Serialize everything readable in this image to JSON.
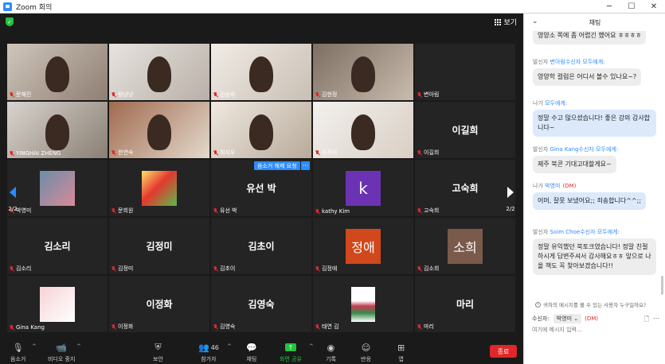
{
  "window": {
    "title": "Zoom 회의",
    "minimize": "─",
    "maximize": "☐",
    "close": "✕"
  },
  "view_button": "보기",
  "tiles": [
    {
      "name": "문혜진",
      "big": ""
    },
    {
      "name": "탱냥냥",
      "big": ""
    },
    {
      "name": "김송희",
      "big": ""
    },
    {
      "name": "김현정",
      "big": ""
    },
    {
      "name": "변아림",
      "big": ""
    },
    {
      "name": "YINGHAI ZHENG",
      "big": ""
    },
    {
      "name": "한연숙",
      "big": ""
    },
    {
      "name": "최지우",
      "big": ""
    },
    {
      "name": "조주미",
      "big": ""
    },
    {
      "name": "이길희",
      "big": "이길희"
    },
    {
      "name": "박영미",
      "big": ""
    },
    {
      "name": "문희원",
      "big": ""
    },
    {
      "name": "유선 박",
      "big": "유선 박"
    },
    {
      "name": "kathy Kim",
      "big": "",
      "avatar": "k"
    },
    {
      "name": "고숙희",
      "big": "고숙희"
    },
    {
      "name": "김소리",
      "big": "김소리"
    },
    {
      "name": "김정미",
      "big": "김정미"
    },
    {
      "name": "김초이",
      "big": "김초이"
    },
    {
      "name": "김정애",
      "big": "",
      "avatar": "정애"
    },
    {
      "name": "김소희",
      "big": "",
      "avatar": "소희"
    },
    {
      "name": "Gina Kang",
      "big": ""
    },
    {
      "name": "이정화",
      "big": "이정화"
    },
    {
      "name": "김영숙",
      "big": "김영숙"
    },
    {
      "name": "태연 김",
      "big": ""
    },
    {
      "name": "마리",
      "big": "마리"
    }
  ],
  "page_indicator_left": "2/2",
  "page_indicator_right": "2/2",
  "tooltip": {
    "label": "음소거 해제 요청",
    "more": "···"
  },
  "toolbar": {
    "mute": "음소거",
    "video": "비디오 중지",
    "security": "보안",
    "participants": "참가자",
    "participant_count": "46",
    "chat": "채팅",
    "share": "화면 공유",
    "record": "기록",
    "reactions": "반응",
    "apps": "앱",
    "end": "종료"
  },
  "chat": {
    "header": "채팅",
    "messages": [
      {
        "meta_a": "",
        "meta_b": "",
        "meta_c": "",
        "text": "영양소 쪽에 좀 어렵긴 했어요 ㅎㅎㅎㅎ",
        "style": "gray"
      },
      {
        "meta_a": "발신자 ",
        "meta_b": "변아림",
        "meta_c": "수신자 모두에게:",
        "text": "영양학 컬럼은 어디서 볼수 있나요~?",
        "style": "gray"
      },
      {
        "meta_a": "나가 ",
        "meta_b": "모두에게:",
        "meta_c": "",
        "text": "정말 수고 많으셨습니다! 좋은 강의 감사합니다~",
        "style": "blue"
      },
      {
        "meta_a": "발신자 ",
        "meta_b": "Gina Kang",
        "meta_c": "수신자 모두에게:",
        "text": "제주 북콘 기대고대할게요~",
        "style": "gray"
      },
      {
        "meta_a": "나가 ",
        "meta_b": "박영미",
        "meta_c": "(DM)",
        "text": "어머, 잘못 보냈어요;; 죄송합니다^^;;",
        "style": "blue"
      },
      {
        "meta_a": "발신자 ",
        "meta_b": "Soim Choe",
        "meta_c": "수신자 모두에게:",
        "text": "정말 유익했던 북토크였습니다! 정말 친절하시게 답변주셔서 감사해요ㅎㅎ 앞으로 나올 책도 꼭 찾아보겠습니다!!",
        "style": "gray"
      }
    ],
    "notice": "귀하의 메시지를 볼 수 있는 사용자 누구일까요?",
    "to_label": "수신자:",
    "to_value": "박영미 ⌄",
    "to_dm": "(DM)",
    "input_placeholder": "여기에 메시지 입력..."
  }
}
